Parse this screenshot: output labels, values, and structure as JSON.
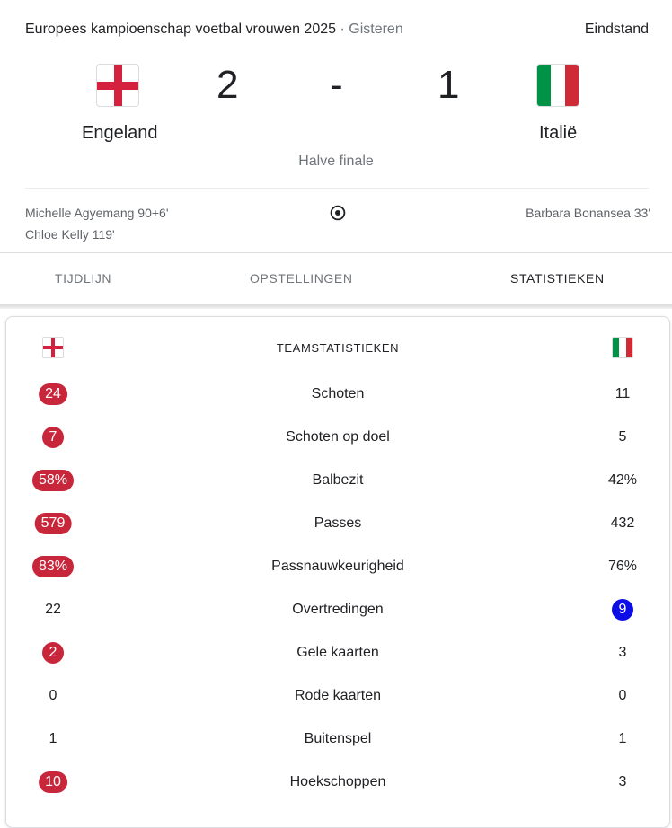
{
  "header": {
    "competition": "Europees kampioenschap voetbal vrouwen 2025",
    "separator": "·",
    "date": "Gisteren",
    "status": "Eindstand"
  },
  "match": {
    "home": {
      "name": "Engeland",
      "flag_icon": "england-flag-icon",
      "score": "2"
    },
    "away": {
      "name": "Italië",
      "flag_icon": "italy-flag-icon",
      "score": "1"
    },
    "score_separator": "-",
    "round": "Halve finale"
  },
  "goals": {
    "home_scorers": [
      "Michelle Agyemang 90+6'",
      "Chloe Kelly 119'"
    ],
    "away_scorers": [
      "Barbara Bonansea 33'"
    ],
    "icon": "soccer-ball-icon"
  },
  "tabs": [
    {
      "label": "TIJDLIJN",
      "active": false
    },
    {
      "label": "OPSTELLINGEN",
      "active": false
    },
    {
      "label": "STATISTIEKEN",
      "active": true
    }
  ],
  "stats": {
    "title": "TEAMSTATISTIEKEN",
    "rows": [
      {
        "label": "Schoten",
        "home": "24",
        "away": "11",
        "highlight": "home"
      },
      {
        "label": "Schoten op doel",
        "home": "7",
        "away": "5",
        "highlight": "home"
      },
      {
        "label": "Balbezit",
        "home": "58%",
        "away": "42%",
        "highlight": "home"
      },
      {
        "label": "Passes",
        "home": "579",
        "away": "432",
        "highlight": "home"
      },
      {
        "label": "Passnauwkeurigheid",
        "home": "83%",
        "away": "76%",
        "highlight": "home"
      },
      {
        "label": "Overtredingen",
        "home": "22",
        "away": "9",
        "highlight": "away"
      },
      {
        "label": "Gele kaarten",
        "home": "2",
        "away": "3",
        "highlight": "home"
      },
      {
        "label": "Rode kaarten",
        "home": "0",
        "away": "0",
        "highlight": "none"
      },
      {
        "label": "Buitenspel",
        "home": "1",
        "away": "1",
        "highlight": "none"
      },
      {
        "label": "Hoekschoppen",
        "home": "10",
        "away": "3",
        "highlight": "home"
      }
    ]
  },
  "colors": {
    "home_accent": "#c8263a",
    "away_accent": "#0d0de6",
    "england_red": "#d4213d",
    "italy_green": "#009246",
    "italy_white": "#ffffff",
    "italy_red": "#ce2b37"
  }
}
